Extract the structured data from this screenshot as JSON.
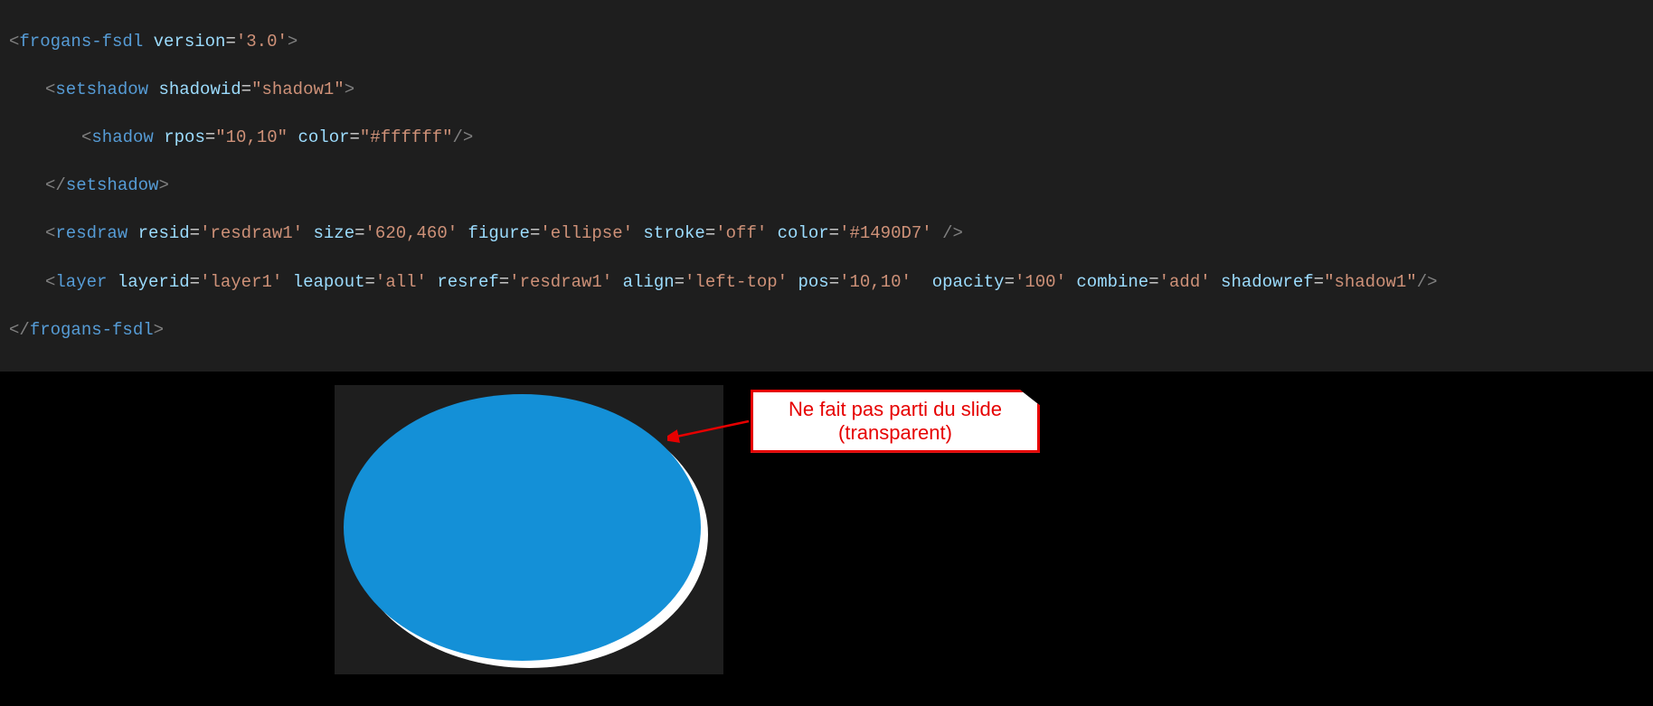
{
  "code": {
    "l0": {
      "tag": "frogans-fsdl",
      "attrs": [
        {
          "n": "version",
          "v": "'3.0'"
        }
      ]
    },
    "l1": {
      "tag": "setshadow",
      "attrs": [
        {
          "n": "shadowid",
          "v": "\"shadow1\""
        }
      ]
    },
    "l2": {
      "tag": "shadow",
      "attrs": [
        {
          "n": "rpos",
          "v": "\"10,10\""
        },
        {
          "n": "color",
          "v": "\"#ffffff\""
        }
      ],
      "self": true
    },
    "l3": {
      "closeTag": "setshadow"
    },
    "l4": {
      "tag": "resdraw",
      "attrs": [
        {
          "n": "resid",
          "v": "'resdraw1'"
        },
        {
          "n": "size",
          "v": "'620,460'"
        },
        {
          "n": "figure",
          "v": "'ellipse'"
        },
        {
          "n": "stroke",
          "v": "'off'"
        },
        {
          "n": "color",
          "v": "'#1490D7'"
        }
      ],
      "self": true,
      "space": true
    },
    "l5": {
      "tag": "layer",
      "attrs": [
        {
          "n": "layerid",
          "v": "'layer1'"
        },
        {
          "n": "leapout",
          "v": "'all'"
        },
        {
          "n": "resref",
          "v": "'resdraw1'"
        },
        {
          "n": "align",
          "v": "'left-top'"
        },
        {
          "n": "pos",
          "v": "'10,10'",
          "dbl": true
        },
        {
          "n": "opacity",
          "v": "'100'"
        },
        {
          "n": "combine",
          "v": "'add'"
        },
        {
          "n": "shadowref",
          "v": "\"shadow1\""
        }
      ],
      "self": true
    },
    "l6": {
      "closeTag": "frogans-fsdl"
    }
  },
  "callout": {
    "line1": "Ne fait pas parti du slide",
    "line2": "(transparent)"
  },
  "colors": {
    "ellipse": "#1490d7",
    "shadow": "#ffffff",
    "callout": "#e60000",
    "codeBg": "#1e1e1e"
  }
}
